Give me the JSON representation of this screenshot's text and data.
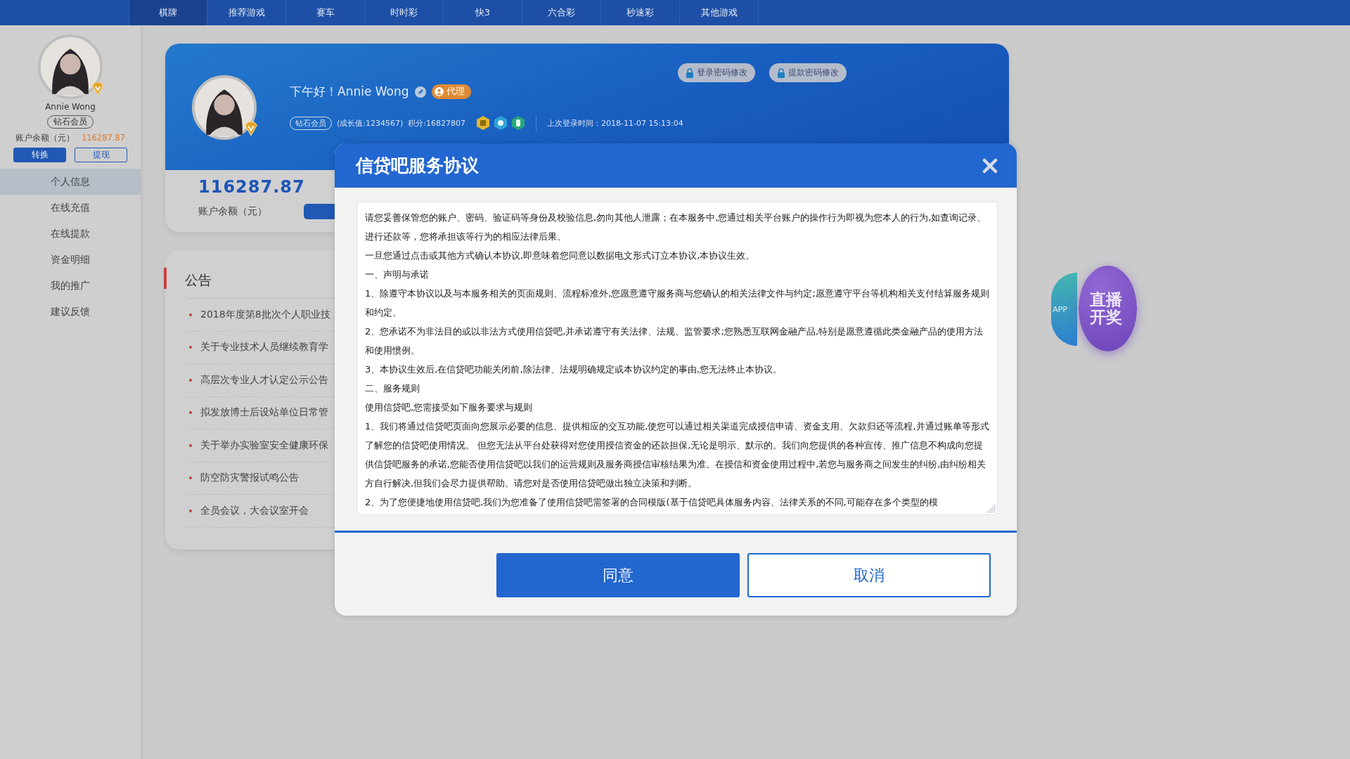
{
  "nav": {
    "items": [
      {
        "label": "棋牌",
        "selected": true
      },
      {
        "label": "推荐游戏",
        "selected": false
      },
      {
        "label": "赛车",
        "selected": false
      },
      {
        "label": "时时彩",
        "selected": false
      },
      {
        "label": "快3",
        "selected": false
      },
      {
        "label": "六合彩",
        "selected": false
      },
      {
        "label": "秒速彩",
        "selected": false
      },
      {
        "label": "其他游戏",
        "selected": false
      }
    ]
  },
  "sidebar": {
    "user_name": "Annie Wong",
    "member_level": "钻石会员",
    "balance_label": "账户余额（元）",
    "balance_value": "116287.87",
    "buttons": [
      {
        "label": "转换",
        "kind": "primary"
      },
      {
        "label": "提现",
        "kind": "outline"
      }
    ],
    "menu": [
      {
        "label": "个人信息",
        "selected": true
      },
      {
        "label": "在线充值",
        "selected": false
      },
      {
        "label": "在线提款",
        "selected": false
      },
      {
        "label": "资金明细",
        "selected": false
      },
      {
        "label": "我的推广",
        "selected": false
      },
      {
        "label": "建议反馈",
        "selected": false
      }
    ]
  },
  "profile": {
    "greeting": "下午好！Annie Wong",
    "role_badge": "代理",
    "member_level": "钻石会员",
    "growth": "(成长值:1234567)",
    "points": "积分:16827807",
    "last_login": "上次登录时间：2018-11-07 15:13:04",
    "security_buttons": [
      "登录密码修改",
      "提款密码修改"
    ],
    "balance_value": "116287.87",
    "balance_label": "账户余额（元）"
  },
  "announcements": {
    "title": "公告",
    "items": [
      "2018年度第8批次个人职业技",
      "关于专业技术人员继续教育学",
      "高层次专业人才认定公示公告",
      "拟发放博士后设站单位日常管",
      "关于举办实验室安全健康环保",
      "防空防灾警报试鸣公告",
      "全员会议，大会议室开会"
    ]
  },
  "floating": {
    "app_label": "APP",
    "live_label": "直播开奖"
  },
  "modal": {
    "title": "信贷吧服务协议",
    "paragraphs": [
      " 请您妥善保管您的账户、密码、验证码等身份及校验信息,勿向其他人泄露；在本服务中,您通过相关平台账户的操作行为即视为您本人的行为,如查询记录、进行还款等，您将承担该等行为的相应法律后果。",
      "一旦您通过点击或其他方式确认本协议,即意味着您同意以数据电文形式订立本协议,本协议生效。",
      "一、声明与承诺",
      "1、除遵守本协议以及与本服务相关的页面规则、流程标准外,您愿意遵守服务商与您确认的相关法律文件与约定;愿意遵守平台等机构相关支付结算服务规则和约定。",
      "2、您承诺不为非法目的或以非法方式使用信贷吧,并承诺遵守有关法律、法规、监管要求;您熟悉互联网金融产品,特别是愿意遵循此类金融产品的使用方法和使用惯例。",
      "3、本协议生效后,在信贷吧功能关闭前,除法律、法规明确规定或本协议约定的事由,您无法终止本协议。",
      "二、服务规则",
      "使用信贷吧,您需接受如下服务要求与规则",
      "1、我们将通过信贷吧页面向您展示必要的信息、提供相应的交互功能,使您可以通过相关渠道完成授信申请、资金支用、欠款归还等流程,并通过账单等形式了解您的信贷吧使用情况。 但您无法从平台处获得对您使用授信资金的还款担保,无论是明示、默示的。我们向您提供的各种宣传、推广信息不构成向您提供信贷吧服务的承诺,您能否使用信贷吧以我们的运营规则及服务商授信审核结果为准。在授信和资金使用过程中,若您与服务商之间发生的纠纷,由纠纷相关方自行解决,但我们会尽力提供帮助。请您对是否使用信贷吧做出独立决策和判断。",
      "2、为了您便捷地使用信贷吧,我们为您准备了使用信贷吧需签署的合同模版(基于信贷吧具体服务内容、法律关系的不同,可能存在多个类型的模"
    ],
    "buttons": [
      {
        "label": "同意",
        "kind": "primary"
      },
      {
        "label": "取消",
        "kind": "secondary"
      }
    ]
  }
}
